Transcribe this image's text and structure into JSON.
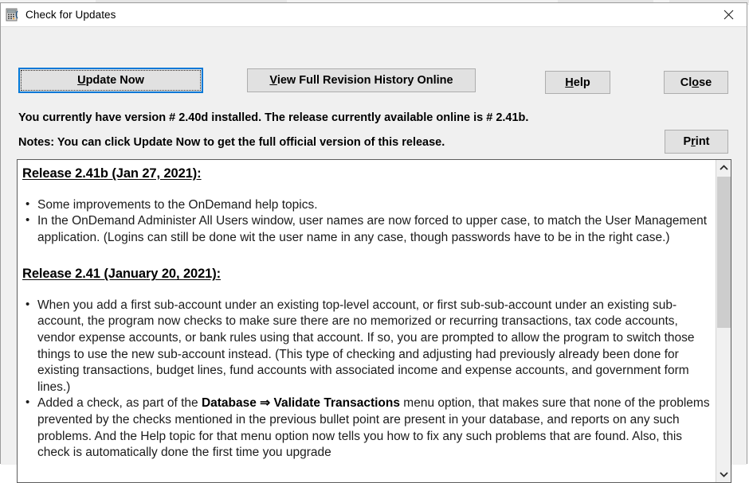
{
  "window": {
    "title": "Check for Updates",
    "app_icon": "calculator-icon",
    "close_icon": "close-icon"
  },
  "toolbar": {
    "update_now": {
      "label": "Update Now",
      "accel": "U",
      "focused": true
    },
    "view_history": {
      "label": "View Full Revision History Online",
      "accel": "V"
    },
    "help": {
      "label": "Help",
      "accel": "H"
    },
    "close": {
      "label": "Close",
      "accel": "o"
    },
    "print": {
      "label": "Print",
      "accel": "r"
    }
  },
  "info": {
    "version_line": "You currently have version # 2.40d installed.  The release currently available online is # 2.41b.",
    "notes_line": "Notes: You can click Update Now to get the full official version of this release.",
    "installed_version": "2.40d",
    "online_version": "2.41b"
  },
  "releases": [
    {
      "heading": "Release 2.41b (Jan 27, 2021):",
      "version": "2.41b",
      "date": "Jan 27, 2021",
      "bullets": [
        "Some improvements to the OnDemand help topics.",
        "In the OnDemand Administer All Users window, user names are now forced to upper case, to match the User Management application. (Logins can still be done wit the user name in any case, though passwords have to be in the right case.)"
      ]
    },
    {
      "heading": "Release 2.41 (January 20, 2021):",
      "version": "2.41",
      "date": "January 20, 2021",
      "bullets": [
        "When you add a first sub-account under an existing top-level account, or first sub-sub-account under an existing sub-account, the program now checks to make sure there are no memorized or recurring transactions, tax code accounts, vendor expense accounts, or bank rules using that account. If so, you are prompted to allow the program to switch those things to use the new sub-account instead. (This type of checking and adjusting had previously already been done for existing transactions, budget lines, fund accounts with associated income and expense accounts, and government form lines.)"
      ],
      "bullet_last": {
        "prefix": "Added a check, as part of the ",
        "bold": "Database ⇒ Validate Transactions",
        "suffix": " menu option, that makes sure that none of the problems prevented by the checks mentioned in the previous bullet point are present in your database, and reports on any such problems. And the Help topic for that menu option now tells you how to fix any such problems that are found. Also, this check is automatically done the first time you upgrade"
      }
    }
  ],
  "scrollbar": {
    "up_icon": "chevron-up-icon",
    "down_icon": "chevron-down-icon",
    "thumb": "scroll-thumb"
  },
  "colors": {
    "dialog_bg": "#f0f0f0",
    "button_face": "#e1e1e1",
    "focus_blue": "#0078d7",
    "content_bg": "#ffffff",
    "scroll_thumb": "#cdcdcd"
  }
}
